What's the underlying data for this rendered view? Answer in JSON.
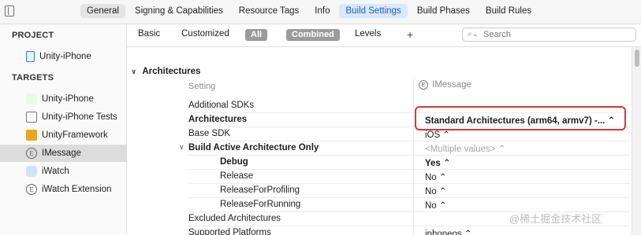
{
  "tabs": [
    "General",
    "Signing & Capabilities",
    "Resource Tags",
    "Info",
    "Build Settings",
    "Build Phases",
    "Build Rules"
  ],
  "sidebar": {
    "project_header": "PROJECT",
    "project_item": "Unity-iPhone",
    "targets_header": "TARGETS",
    "targets": [
      "Unity-iPhone",
      "Unity-iPhone Tests",
      "UnityFramework",
      "IMessage",
      "iWatch",
      "iWatch Extension"
    ],
    "selected_target": "IMessage"
  },
  "filter": {
    "basic": "Basic",
    "customized": "Customized",
    "all": "All",
    "combined": "Combined",
    "levels": "Levels",
    "plus": "+",
    "search_placeholder": "Search"
  },
  "group": {
    "title": "Architectures"
  },
  "columns": {
    "setting": "Setting",
    "target": "IMessage"
  },
  "rows": [
    {
      "name": "Additional SDKs",
      "value": ""
    },
    {
      "name": "Architectures",
      "value": "Standard Architectures (arm64, armv7)  -...  ⌃"
    },
    {
      "name": "Base SDK",
      "value": "iOS ⌃"
    },
    {
      "name": "Build Active Architecture Only",
      "value": "<Multiple values> ⌃"
    },
    {
      "name": "Debug",
      "value": "Yes ⌃"
    },
    {
      "name": "Release",
      "value": "No ⌃"
    },
    {
      "name": "ReleaseForProfiling",
      "value": "No ⌃"
    },
    {
      "name": "ReleaseForRunning",
      "value": "No ⌃"
    },
    {
      "name": "Excluded Architectures",
      "value": ""
    },
    {
      "name": "Supported Platforms",
      "value": "iphoneos ⌃"
    }
  ],
  "watermark": "@稀土掘金技术社区",
  "colors": {
    "accent": "#1a5fce",
    "highlight": "#d7372c"
  }
}
